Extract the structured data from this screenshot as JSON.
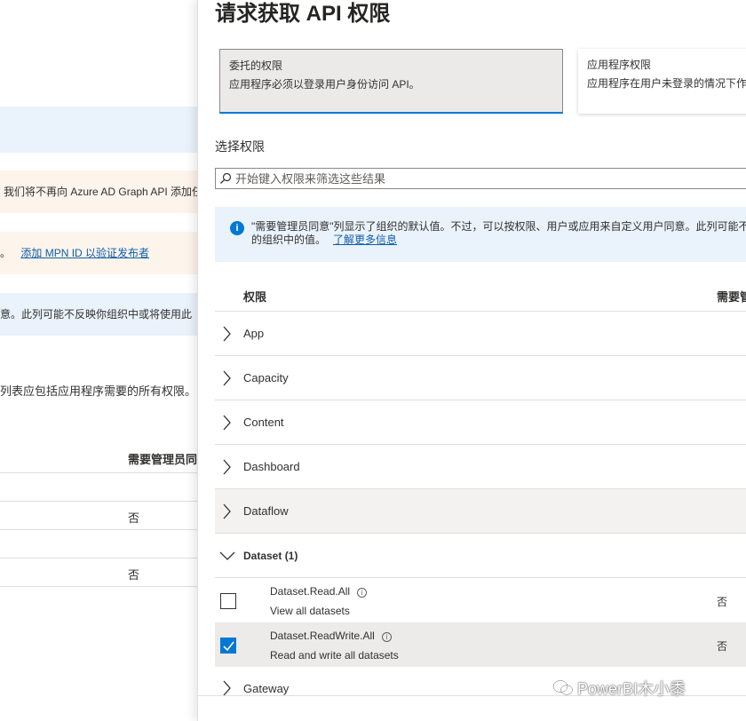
{
  "background": {
    "notice_graph": "我们将不再向 Azure AD Graph API 添加任",
    "notice_mpn_text": "。",
    "notice_mpn_link": "添加 MPN ID 以验证发布者",
    "notice_consent": "意。此列可能不反映你组织中或将使用此",
    "list_text": "列表应包括应用程序需要的所有权限。",
    "column_header": "需要管理员同",
    "row_values": [
      "否",
      "否"
    ]
  },
  "panel": {
    "title": "请求获取 API 权限",
    "delegated": {
      "title": "委托的权限",
      "description": "应用程序必须以登录用户身份访问 API。"
    },
    "application": {
      "title": "应用程序权限",
      "description": "应用程序在用户未登录的情况下作"
    },
    "select_label": "选择权限",
    "search": {
      "placeholder": "开始键入权限来筛选这些结果",
      "value": ""
    },
    "info": {
      "line1": "\"需要管理员同意\"列显示了组织的默认值。不过，可以按权限、用户或应用来自定义用户同意。此列可能不",
      "line2": "的组织中的值。",
      "link": "了解更多信息"
    },
    "table": {
      "col_permission": "权限",
      "col_admin": "需要管"
    },
    "groups": [
      {
        "label": "App"
      },
      {
        "label": "Capacity"
      },
      {
        "label": "Content"
      },
      {
        "label": "Dashboard"
      },
      {
        "label": "Dataflow"
      },
      {
        "label": "Dataset (1)"
      }
    ],
    "permissions": [
      {
        "name": "Dataset.Read.All",
        "description": "View all datasets",
        "admin": "否",
        "checked": false
      },
      {
        "name": "Dataset.ReadWrite.All",
        "description": "Read and write all datasets",
        "admin": "否",
        "checked": true
      }
    ],
    "last_group": "Gateway"
  },
  "watermark": "PowerBI木小黍",
  "colors": {
    "accent": "#0078d4",
    "link": "#0f5fab",
    "info_bg": "#eaf2fb",
    "warn_bg": "#fdf4ec"
  }
}
